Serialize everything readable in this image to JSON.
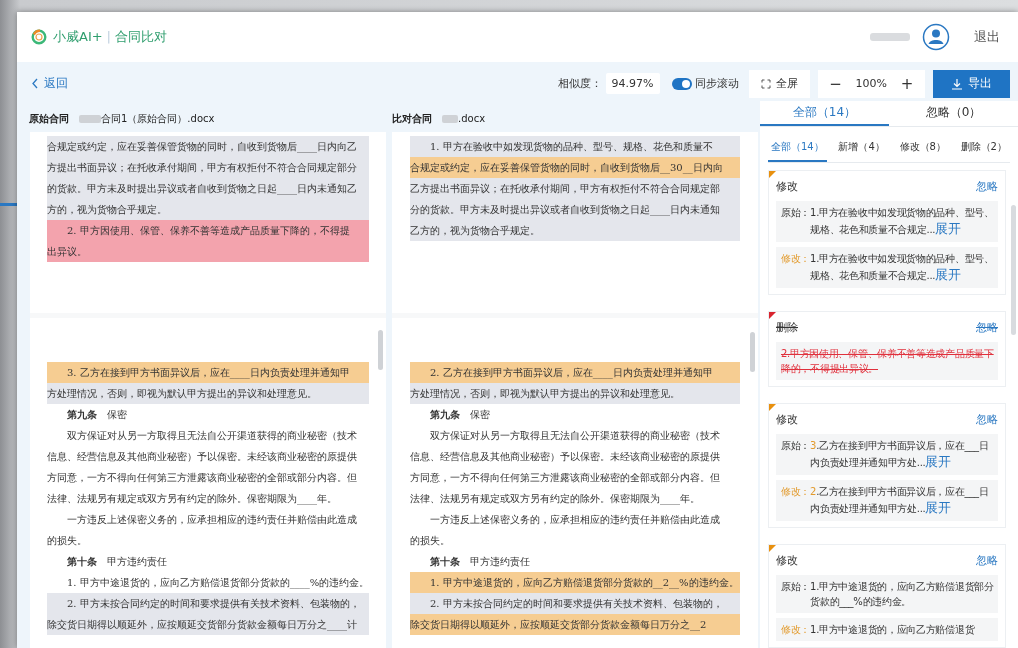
{
  "header": {
    "brand": "小威AI+",
    "separator": "|",
    "title": "合同比对",
    "logout": "退出"
  },
  "toolbar": {
    "back": "返回",
    "similarity_label": "相似度：",
    "similarity_value": "94.97%",
    "sync_scroll": {
      "label": "同步滚动",
      "on": true
    },
    "fullscreen": "全屏",
    "zoom_out": "−",
    "zoom_value": "100%",
    "zoom_in": "+",
    "export": "导出"
  },
  "documents": [
    {
      "label": "原始合同",
      "filename": "合同1（原始合同）.docx",
      "pages": [
        [
          {
            "text": "合规定或约定，应在妥善保管货物的同时，自收到货物后____日内向乙",
            "kind": "context",
            "indent": false
          },
          {
            "text": "方提出书面异议；在托收承付期间，甲方有权拒付不符合合同规定部分",
            "kind": "context",
            "indent": false
          },
          {
            "text": "的货款。甲方未及时提出异议或者自收到货物之日起____日内未通知乙",
            "kind": "context",
            "indent": false
          },
          {
            "text": "方的，视为货物合乎规定。",
            "kind": "context",
            "indent": false
          },
          {
            "text": "2. 甲方因使用、保管、保养不善等造成产品质量下降的，不得提",
            "kind": "deleted",
            "indent": true
          },
          {
            "text": "出异议。",
            "kind": "deleted",
            "indent": false
          }
        ],
        [
          {
            "text": "3. 乙方在接到甲方书面异议后，应在____日内负责处理并通知甲",
            "kind": "modified",
            "indent": true
          },
          {
            "text": "方处理情况，否则，即视为默认甲方提出的异议和处理意见。",
            "kind": "context",
            "indent": false
          },
          {
            "text": "**第九条**　保密",
            "kind": "plain",
            "indent": true
          },
          {
            "text": "双方保证对从另一方取得且无法自公开渠道获得的商业秘密（技术",
            "kind": "plain",
            "indent": true
          },
          {
            "text": "信息、经营信息及其他商业秘密）予以保密。未经该商业秘密的原提供",
            "kind": "plain",
            "indent": false
          },
          {
            "text": "方同意，一方不得向任何第三方泄露该商业秘密的全部或部分内容。但",
            "kind": "plain",
            "indent": false
          },
          {
            "text": "法律、法规另有规定或双方另有约定的除外。保密期限为____年。",
            "kind": "plain",
            "indent": false
          },
          {
            "text": "一方违反上述保密义务的，应承担相应的违约责任并赔偿由此造成",
            "kind": "plain",
            "indent": true
          },
          {
            "text": "的损失。",
            "kind": "plain",
            "indent": false
          },
          {
            "text": "**第十条**　甲方违约责任",
            "kind": "plain",
            "indent": true
          },
          {
            "text": "1. 甲方中途退货的，应向乙方赔偿退货部分货款的____%的违约金。",
            "kind": "plain",
            "indent": true
          },
          {
            "text": "2. 甲方未按合同约定的时间和要求提供有关技术资料、包装物的，",
            "kind": "context",
            "indent": true
          },
          {
            "text": "除交货日期得以顺延外，应按顺延交货部分货款金额每日万分之____计",
            "kind": "context",
            "indent": false
          }
        ]
      ]
    },
    {
      "label": "比对合同",
      "filename": ".docx",
      "pages": [
        [
          {
            "text": "1. 甲方在验收中如发现货物的品种、型号、规格、花色和质量不",
            "kind": "context",
            "indent": true
          },
          {
            "text": "合规定或约定，应在妥善保管货物的同时，自收到货物后__30__日内向",
            "kind": "modified",
            "indent": false
          },
          {
            "text": "乙方提出书面异议；在托收承付期间，甲方有权拒付不符合合同规定部",
            "kind": "context",
            "indent": false
          },
          {
            "text": "分的货款。甲方未及时提出异议或者自收到货物之日起____日内未通知",
            "kind": "context",
            "indent": false
          },
          {
            "text": "乙方的，视为货物合乎规定。",
            "kind": "context",
            "indent": false
          }
        ],
        [
          {
            "text": "2. 乙方在接到甲方书面异议后，应在____日内负责处理并通知甲",
            "kind": "modified",
            "indent": true
          },
          {
            "text": "方处理情况，否则，即视为默认甲方提出的异议和处理意见。",
            "kind": "context",
            "indent": false
          },
          {
            "text": "**第九条**　保密",
            "kind": "plain",
            "indent": true
          },
          {
            "text": "双方保证对从另一方取得且无法自公开渠道获得的商业秘密（技术",
            "kind": "plain",
            "indent": true
          },
          {
            "text": "信息、经营信息及其他商业秘密）予以保密。未经该商业秘密的原提供",
            "kind": "plain",
            "indent": false
          },
          {
            "text": "方同意，一方不得向任何第三方泄露该商业秘密的全部或部分内容。但",
            "kind": "plain",
            "indent": false
          },
          {
            "text": "法律、法规另有规定或双方另有约定的除外。保密期限为____年。",
            "kind": "plain",
            "indent": false
          },
          {
            "text": "一方违反上述保密义务的，应承担相应的违约责任并赔偿由此造成",
            "kind": "plain",
            "indent": true
          },
          {
            "text": "的损失。",
            "kind": "plain",
            "indent": false
          },
          {
            "text": "**第十条**　甲方违约责任",
            "kind": "plain",
            "indent": true
          },
          {
            "text": "1. 甲方中途退货的，应向乙方赔偿退货部分货款的__2__%的违约金。",
            "kind": "modified",
            "indent": true
          },
          {
            "text": "2. 甲方未按合同约定的时间和要求提供有关技术资料、包装物的，",
            "kind": "context",
            "indent": true
          },
          {
            "text": "除交货日期得以顺延外，应按顺延交货部分货款金额每日万分之__2",
            "kind": "modified",
            "indent": false
          }
        ]
      ]
    }
  ],
  "diff_panel": {
    "tabs": [
      {
        "label": "全部（14）",
        "selected": true
      },
      {
        "label": "忽略（0）",
        "selected": false
      }
    ],
    "filters": [
      {
        "label": "全部（14）",
        "selected": true
      },
      {
        "label": "新增（4）",
        "selected": false
      },
      {
        "label": "修改（8）",
        "selected": false
      },
      {
        "label": "删除（2）",
        "selected": false
      }
    ],
    "cards": [
      {
        "kind": "modify",
        "title": "修改",
        "ignore": "忽略",
        "rows": [
          {
            "kind": "original",
            "label": "原始：",
            "number": "1",
            "text": ".甲方在验收中如发现货物的品种、型号、规格、花色和质量不合规定...",
            "more": "展开"
          },
          {
            "kind": "modified",
            "label": "修改：",
            "number": "1",
            "text": ".甲方在验收中如发现货物的品种、型号、规格、花色和质量不合规定...",
            "more": "展开"
          }
        ]
      },
      {
        "kind": "delete",
        "title": "删除",
        "ignore": "忽略",
        "rows": [
          {
            "kind": "deleted",
            "text": "2.甲方因使用、保管、保养不善等造成产品质量下降的，不得提出异议。"
          }
        ]
      },
      {
        "kind": "modify",
        "title": "修改",
        "ignore": "忽略",
        "rows": [
          {
            "kind": "original",
            "label": "原始：",
            "number": "3",
            "number_changed": true,
            "text": ".乙方在接到甲方书面异议后，应在___日内负责处理并通知甲方处...",
            "more": "展开"
          },
          {
            "kind": "modified",
            "label": "修改：",
            "number": "2",
            "number_changed": true,
            "text": ".乙方在接到甲方书面异议后，应在___日内负责处理并通知甲方处...",
            "more": "展开"
          }
        ]
      },
      {
        "kind": "modify",
        "title": "修改",
        "ignore": "忽略",
        "rows": [
          {
            "kind": "original",
            "label": "原始：",
            "number": "1",
            "text": ".甲方中途退货的，应向乙方赔偿退货部分货款的___%的违约金。"
          },
          {
            "kind": "modified",
            "label": "修改：",
            "number": "1",
            "text": ".甲方中途退货的，应向乙方赔偿退货"
          }
        ]
      }
    ]
  }
}
